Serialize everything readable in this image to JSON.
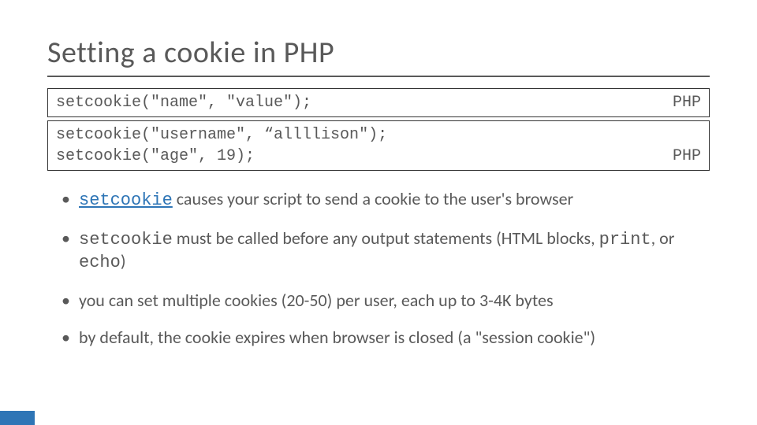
{
  "title": "Setting a cookie in PHP",
  "code1": {
    "text": "setcookie(\"name\", \"value\");",
    "lang": "PHP"
  },
  "code2": {
    "line1": "setcookie(\"username\", “allllison\");",
    "line2": "setcookie(\"age\", 19);",
    "lang": "PHP"
  },
  "bullets": {
    "b1": {
      "fn": "setcookie",
      "rest": " causes your script to send a cookie to the user's browser"
    },
    "b2": {
      "fn": "setcookie",
      "mid": " must be called before any output statements (HTML blocks, ",
      "fn2": "print",
      "mid2": ", or ",
      "fn3": "echo",
      "tail": ")"
    },
    "b3": {
      "text": "you can set multiple cookies (20-50) per user, each up to 3-4K bytes"
    },
    "b4": {
      "text": "by default, the cookie expires when browser is closed (a \"session cookie\")"
    }
  }
}
